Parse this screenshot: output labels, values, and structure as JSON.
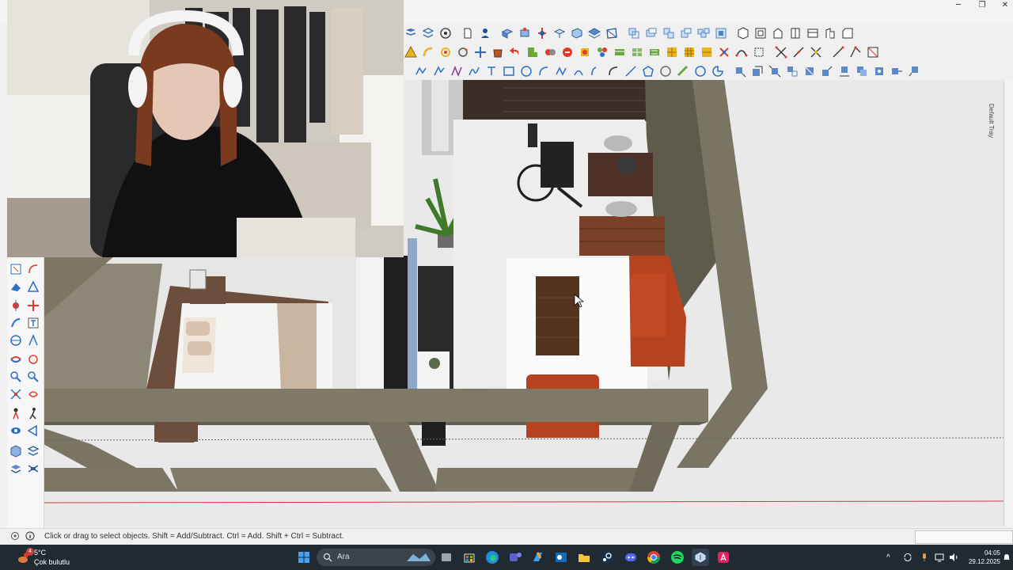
{
  "window": {
    "controls": {
      "minimize": "─",
      "restore": "❐",
      "close": "✕"
    }
  },
  "tray": {
    "label": "Default Tray"
  },
  "status": {
    "hint": "Click or drag to select objects. Shift = Add/Subtract. Ctrl = Add. Shift + Ctrl = Subtract."
  },
  "taskbar": {
    "weather": {
      "temp": "5°C",
      "desc": "Çok bulutlu",
      "badge": "4"
    },
    "search_label": "Ara",
    "clock": {
      "time": "04:05",
      "date": "29.12.2025"
    },
    "apps": [
      "start-icon",
      "search-icon",
      "widgets-icon",
      "task-view-icon",
      "store-icon",
      "edge-icon",
      "teams-icon",
      "copilot-icon",
      "outlook-icon",
      "file-explorer-icon",
      "steam-icon",
      "discord-icon",
      "chrome-icon",
      "spotify-icon",
      "sketchup-icon",
      "adobe-icon"
    ]
  },
  "colors": {
    "accent_red": "#e23a2a",
    "accent_blue": "#2b6fc9",
    "accent_yellow": "#e8b520",
    "wall": "#7a7462",
    "floor": "#e4e4e2",
    "taskbar": "#1f2a33"
  }
}
